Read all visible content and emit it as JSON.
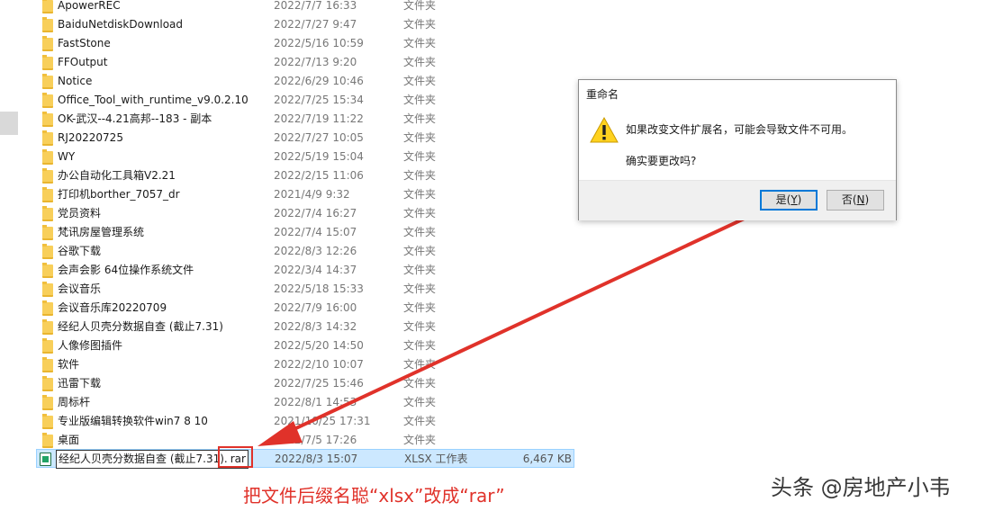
{
  "files": [
    {
      "name": "ApowerREC",
      "date": "2022/7/7 16:33",
      "type": "文件夹"
    },
    {
      "name": "BaiduNetdiskDownload",
      "date": "2022/7/27 9:47",
      "type": "文件夹"
    },
    {
      "name": "FastStone",
      "date": "2022/5/16 10:59",
      "type": "文件夹"
    },
    {
      "name": "FFOutput",
      "date": "2022/7/13 9:20",
      "type": "文件夹"
    },
    {
      "name": "Notice",
      "date": "2022/6/29 10:46",
      "type": "文件夹"
    },
    {
      "name": "Office_Tool_with_runtime_v9.0.2.10",
      "date": "2022/7/25 15:34",
      "type": "文件夹"
    },
    {
      "name": "OK-武汉--4.21高邦--183 - 副本",
      "date": "2022/7/19 11:22",
      "type": "文件夹"
    },
    {
      "name": "RJ20220725",
      "date": "2022/7/27 10:05",
      "type": "文件夹"
    },
    {
      "name": "WY",
      "date": "2022/5/19 15:04",
      "type": "文件夹"
    },
    {
      "name": "办公自动化工具箱V2.21",
      "date": "2022/2/15 11:06",
      "type": "文件夹"
    },
    {
      "name": "打印机borther_7057_dr",
      "date": "2021/4/9 9:32",
      "type": "文件夹"
    },
    {
      "name": "党员资料",
      "date": "2022/7/4 16:27",
      "type": "文件夹"
    },
    {
      "name": "梵讯房屋管理系统",
      "date": "2022/7/4 15:07",
      "type": "文件夹"
    },
    {
      "name": "谷歌下载",
      "date": "2022/8/3 12:26",
      "type": "文件夹"
    },
    {
      "name": "会声会影 64位操作系统文件",
      "date": "2022/3/4 14:37",
      "type": "文件夹"
    },
    {
      "name": "会议音乐",
      "date": "2022/5/18 15:33",
      "type": "文件夹"
    },
    {
      "name": "会议音乐库20220709",
      "date": "2022/7/9 16:00",
      "type": "文件夹"
    },
    {
      "name": "经纪人贝壳分数据自查 (截止7.31)",
      "date": "2022/8/3 14:32",
      "type": "文件夹"
    },
    {
      "name": "人像修图插件",
      "date": "2022/5/20 14:50",
      "type": "文件夹"
    },
    {
      "name": "软件",
      "date": "2022/2/10 10:07",
      "type": "文件夹"
    },
    {
      "name": "迅雷下载",
      "date": "2022/7/25 15:46",
      "type": "文件夹"
    },
    {
      "name": "周标杆",
      "date": "2022/8/1 14:53",
      "type": "文件夹"
    },
    {
      "name": "专业版编辑转换软件win7 8 10",
      "date": "2021/10/25 17:31",
      "type": "文件夹"
    },
    {
      "name": "桌面",
      "date": "2022/7/5 17:26",
      "type": "文件夹"
    }
  ],
  "selected_file": {
    "name_base": "经纪人贝壳分数据自查 (截止7.31).",
    "name_ext": "rar",
    "date": "2022/8/3 15:07",
    "type": "XLSX 工作表",
    "size": "6,467 KB"
  },
  "dialog": {
    "title": "重命名",
    "message": "如果改变文件扩展名，可能会导致文件不可用。",
    "question": "确实要更改吗?",
    "yes_label": "是(",
    "yes_key": "Y",
    "yes_close": ")",
    "no_label": "否(",
    "no_key": "N",
    "no_close": ")"
  },
  "annotation": {
    "caption": "把文件后缀名聪“xlsx”改成“rar”",
    "color": "#e0322a"
  },
  "watermark": "头条 @房地产小韦"
}
